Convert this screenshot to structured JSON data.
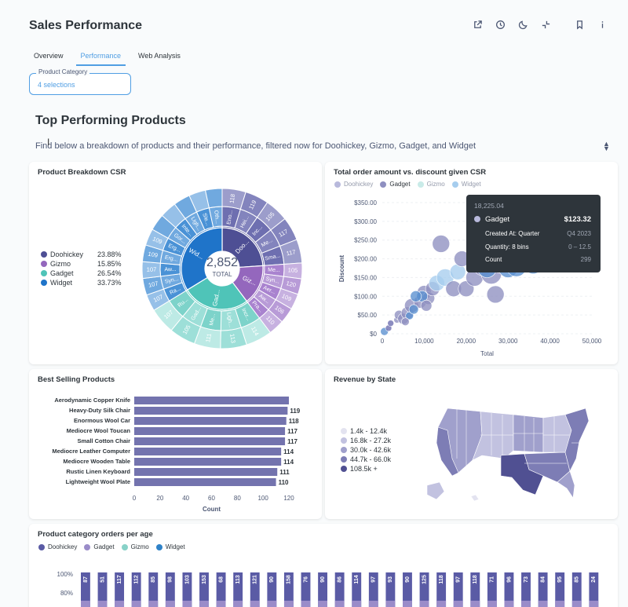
{
  "header": {
    "title": "Sales Performance",
    "icons": [
      "external-link-icon",
      "clock-icon",
      "moon-icon",
      "collapse-icon",
      "bookmark-icon",
      "info-icon"
    ]
  },
  "tabs": [
    {
      "label": "Overview",
      "active": false
    },
    {
      "label": "Performance",
      "active": true
    },
    {
      "label": "Web Analysis",
      "active": false
    }
  ],
  "filter": {
    "label": "Product Category",
    "value": "4 selections"
  },
  "section": {
    "title": "Top Performing Products",
    "description": "Find below a breakdown of products and their performance, filtered now for Doohickey, Gizmo, Gadget, and Widget"
  },
  "colors": {
    "doohickey": "#5a5ba5",
    "gizmo": "#9a8cc9",
    "gadget": "#88d2c8",
    "widget": "#2f82c8",
    "accent": "#509ee3"
  },
  "product_breakdown": {
    "title": "Product Breakdown CSR",
    "total": "2,852",
    "total_label": "TOTAL",
    "legend": [
      {
        "name": "Doohickey",
        "pct": "23.88%",
        "color": "#4e4f94"
      },
      {
        "name": "Gizmo",
        "pct": "15.85%",
        "color": "#9467bd"
      },
      {
        "name": "Gadget",
        "pct": "26.54%",
        "color": "#4fc4b8"
      },
      {
        "name": "Widget",
        "pct": "33.73%",
        "color": "#1f74c9"
      }
    ],
    "inner_labels": [
      "Doo...",
      "Giz...",
      "Gad...",
      "Wid..."
    ],
    "middle_labels": [
      "Eno...",
      "Hei...",
      "Inc...",
      "Me...",
      "Sma...",
      "Me...",
      "Syn...",
      "Aer...",
      "Aw...",
      "Pra...",
      "Incr...",
      "Ligh...",
      "Me...",
      "Gad...",
      "Ru...",
      "Ra...",
      "Syn...",
      "Aw...",
      "Erg...",
      "Erg...",
      "Gor...",
      "Inte...",
      "Ligh...",
      "Sle...",
      "Oth..."
    ],
    "outer_labels": [
      "118",
      "119",
      "105",
      "117",
      "117",
      "105",
      "120",
      "109",
      "106",
      "110",
      "114",
      "113",
      "111",
      "105",
      "107",
      "107",
      "107",
      "107",
      "109",
      "109"
    ]
  },
  "scatter": {
    "title": "Total order amount vs. discount given CSR",
    "legend": [
      {
        "name": "Doohickey",
        "color": "#b8b9dc"
      },
      {
        "name": "Gadget",
        "color": "#8e8fc0"
      },
      {
        "name": "Gizmo",
        "color": "#c9ebe8"
      },
      {
        "name": "Widget",
        "color": "#a6cdee"
      }
    ],
    "y_ticks": [
      "$350.00",
      "$300.00",
      "$250.00",
      "$200.00",
      "$150.00",
      "$100.00",
      "$50.00",
      "$0"
    ],
    "x_ticks": [
      "0",
      "10,000",
      "20,000",
      "30,000",
      "40,000",
      "50,000"
    ],
    "xlabel": "Total",
    "ylabel": "Discount",
    "tooltip": {
      "header": "18,225.04",
      "series": "Gadget",
      "value": "$123.32",
      "rows": [
        {
          "label": "Created At: Quarter",
          "value": "Q4 2023"
        },
        {
          "label": "Quantity: 8 bins",
          "value": "0 – 12.5"
        },
        {
          "label": "Count",
          "value": "299"
        }
      ]
    }
  },
  "chart_data": [
    {
      "type": "bar",
      "title": "Best Selling Products",
      "categories": [
        "Aerodynamic Copper Knife",
        "Heavy-Duty Silk Chair",
        "Enormous Wool Car",
        "Mediocre Wool Toucan",
        "Small Cotton Chair",
        "Mediocre Leather Computer",
        "Mediocre Wooden Table",
        "Rustic Linen Keyboard",
        "Lightweight Wool Plate"
      ],
      "values": [
        120,
        119,
        118,
        117,
        117,
        114,
        114,
        111,
        110
      ],
      "xlabel": "Count",
      "xlim": [
        0,
        120
      ],
      "x_ticks": [
        "0",
        "20",
        "40",
        "60",
        "80",
        "100",
        "120"
      ],
      "value_labels": [
        "",
        "119",
        "118",
        "117",
        "117",
        "114",
        "114",
        "111",
        "110"
      ],
      "color": "#7373ae"
    }
  ],
  "revenue_by_state": {
    "title": "Revenue by State",
    "legend": [
      {
        "label": "1.4k - 12.4k",
        "color": "#e3e3f0"
      },
      {
        "label": "16.8k - 27.2k",
        "color": "#c2c2e0"
      },
      {
        "label": "30.0k - 42.6k",
        "color": "#a0a0cc"
      },
      {
        "label": "44.7k - 66.0k",
        "color": "#7d7db5"
      },
      {
        "label": "108.5k +",
        "color": "#505092"
      }
    ]
  },
  "orders_per_age": {
    "title": "Product category orders per age",
    "legend": [
      {
        "name": "Doohickey",
        "color": "#5a5ba5"
      },
      {
        "name": "Gadget",
        "color": "#9a8cc9"
      },
      {
        "name": "Gizmo",
        "color": "#88d2c8"
      },
      {
        "name": "Widget",
        "color": "#2f82c8"
      }
    ],
    "y_ticks": [
      "100%",
      "80%"
    ],
    "totals": [
      "87",
      "51",
      "117",
      "112",
      "85",
      "98",
      "103",
      "153",
      "68",
      "113",
      "121",
      "90",
      "158",
      "76",
      "90",
      "86",
      "114",
      "97",
      "93",
      "90",
      "125",
      "118",
      "97",
      "118",
      "71",
      "96",
      "73",
      "84",
      "95",
      "85",
      "24"
    ]
  }
}
